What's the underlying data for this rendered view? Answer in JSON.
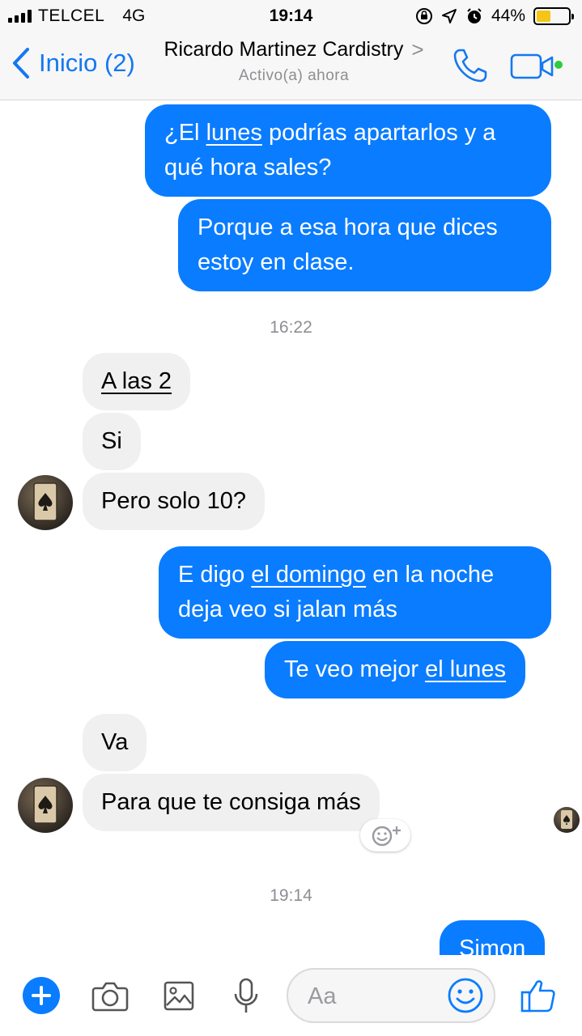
{
  "status_bar": {
    "carrier": "TELCEL",
    "network": "4G",
    "time": "19:14",
    "battery_percent": "44%",
    "battery_level": 0.44
  },
  "nav": {
    "back_label": "Inicio (2)",
    "title": "Ricardo Martinez Cardistry",
    "title_chevron": ">",
    "subtitle": "Activo(a) ahora",
    "accent_color": "#1478f0",
    "online_color": "#2ecc40"
  },
  "messages": {
    "m1": {
      "pre": "¿El ",
      "link": "lunes",
      "post": " podrías apartarlos y a qué hora sales?"
    },
    "m2": {
      "text": "Porque a esa hora que dices estoy en clase."
    },
    "ts1": "16:22",
    "m3": {
      "link": "A las 2"
    },
    "m4": {
      "text": "Si"
    },
    "m5": {
      "text": "Pero solo 10?"
    },
    "m6": {
      "pre": "E digo ",
      "link": "el domingo",
      "post": " en la noche deja veo si jalan más"
    },
    "m7": {
      "pre": "Te veo mejor ",
      "link": "el lunes"
    },
    "m8": {
      "text": "Va"
    },
    "m9": {
      "text": "Para que te consiga más"
    },
    "ts2": "19:14",
    "m10": {
      "text": "Simon"
    }
  },
  "composer": {
    "placeholder": "Aa"
  },
  "colors": {
    "outgoing_bubble": "#0a7cff",
    "incoming_bubble": "#f0f0f0"
  }
}
